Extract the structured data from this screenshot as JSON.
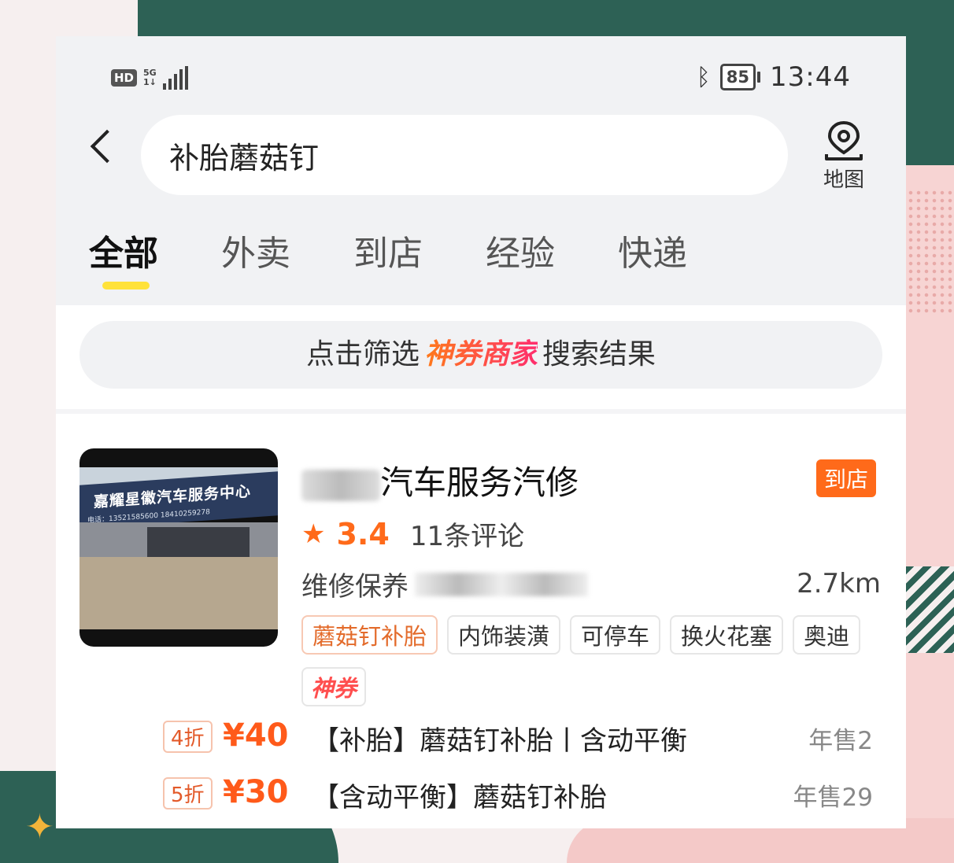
{
  "status_bar": {
    "hd": "HD",
    "network_top": "5G",
    "network_bottom": "1↓",
    "battery": "85",
    "time": "13:44"
  },
  "search": {
    "query": "补胎蘑菇钉",
    "map_label": "地图"
  },
  "tabs": [
    {
      "label": "全部",
      "active": true
    },
    {
      "label": "外卖",
      "active": false
    },
    {
      "label": "到店",
      "active": false
    },
    {
      "label": "经验",
      "active": false
    },
    {
      "label": "快递",
      "active": false
    }
  ],
  "filter_banner": {
    "prefix": "点击筛选",
    "highlight": "神券商家",
    "suffix": "搜索结果"
  },
  "shop": {
    "photo_sign_text": "嘉耀星徽汽车服务中心",
    "photo_sign_sub": "电话：13521585600 18410259278",
    "name_visible": "汽车服务汽修",
    "type_tag": "到店",
    "rating": "3.4",
    "reviews": "11条评论",
    "category": "维修保养",
    "distance": "2.7km",
    "tags": [
      "蘑菇钉补胎",
      "内饰装潢",
      "可停车",
      "换火花塞",
      "奥迪"
    ],
    "coupon_tag": "神券"
  },
  "deals": [
    {
      "discount": "4折",
      "price": "¥40",
      "title": "【补胎】蘑菇钉补胎丨含动平衡",
      "sales": "年售2"
    },
    {
      "discount": "5折",
      "price": "¥30",
      "title": "【含动平衡】蘑菇钉补胎",
      "sales": "年售29"
    }
  ],
  "colors": {
    "accent_orange": "#ff6a1a",
    "tab_underline": "#ffe23a",
    "background_green": "#2d6155",
    "background_pink": "#f7d4d3"
  }
}
